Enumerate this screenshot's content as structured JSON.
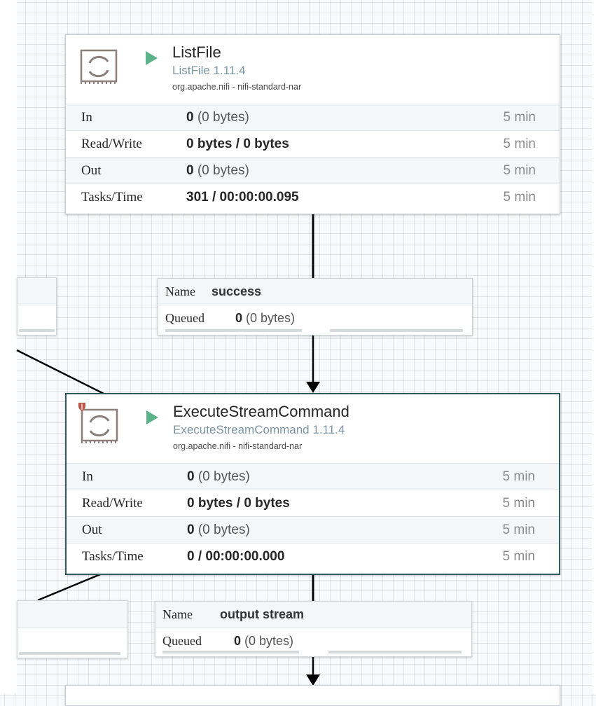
{
  "canvas": {
    "background": "#f9fafb",
    "selected_border": "#2f5a5e",
    "running_color": "#5cb38a",
    "policy_color": "#ba554a"
  },
  "processors": [
    {
      "name": "ListFile",
      "type": "ListFile 1.11.4",
      "bundle": "org.apache.nifi - nifi-standard-nar",
      "run_state": "running",
      "selected": false,
      "stats": [
        {
          "label": "In",
          "count": "0",
          "detail": " (0 bytes)",
          "window": "5 min"
        },
        {
          "label": "Read/Write",
          "count": "0 bytes / 0 bytes",
          "detail": "",
          "window": "5 min"
        },
        {
          "label": "Out",
          "count": "0",
          "detail": " (0 bytes)",
          "window": "5 min"
        },
        {
          "label": "Tasks/Time",
          "count": "301 / 00:00:00.095",
          "detail": "",
          "window": "5 min"
        }
      ]
    },
    {
      "name": "ExecuteStreamCommand",
      "type": "ExecuteStreamCommand 1.11.4",
      "bundle": "org.apache.nifi - nifi-standard-nar",
      "run_state": "running",
      "selected": true,
      "stats": [
        {
          "label": "In",
          "count": "0",
          "detail": " (0 bytes)",
          "window": "5 min"
        },
        {
          "label": "Read/Write",
          "count": "0 bytes / 0 bytes",
          "detail": "",
          "window": "5 min"
        },
        {
          "label": "Out",
          "count": "0",
          "detail": " (0 bytes)",
          "window": "5 min"
        },
        {
          "label": "Tasks/Time",
          "count": "0 / 00:00:00.000",
          "detail": "",
          "window": "5 min"
        }
      ]
    }
  ],
  "connections": [
    {
      "name_key": "Name",
      "name": "success",
      "queued_key": "Queued",
      "queued_count": "0",
      "queued_detail": " (0 bytes)"
    },
    {
      "name_key": "Name",
      "name": "output stream",
      "queued_key": "Queued",
      "queued_count": "0",
      "queued_detail": " (0 bytes)"
    }
  ]
}
